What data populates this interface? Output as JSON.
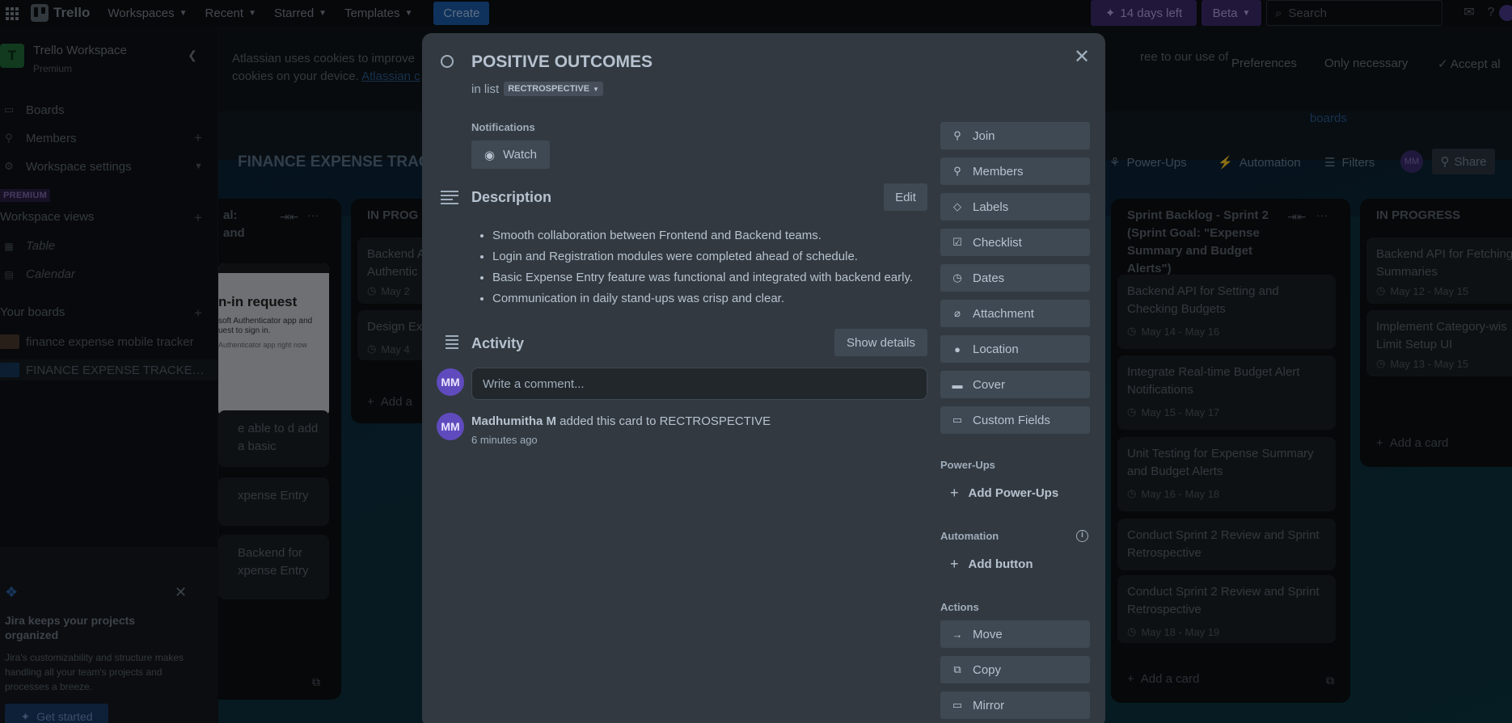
{
  "topbar": {
    "logo_text": "Trello",
    "nav": [
      {
        "label": "Workspaces"
      },
      {
        "label": "Recent"
      },
      {
        "label": "Starred"
      },
      {
        "label": "Templates"
      }
    ],
    "create_label": "Create",
    "trial_label": "14 days left",
    "beta_label": "Beta",
    "search_placeholder": "Search"
  },
  "sidebar": {
    "workspace_initial": "T",
    "workspace_name": "Trello Workspace",
    "workspace_plan": "Premium",
    "items": [
      {
        "label": "Boards"
      },
      {
        "label": "Members"
      },
      {
        "label": "Workspace settings"
      }
    ],
    "premium_tag": "PREMIUM",
    "views_heading": "Workspace views",
    "views": [
      {
        "label": "Table"
      },
      {
        "label": "Calendar"
      }
    ],
    "boards_heading": "Your boards",
    "boards": [
      {
        "name": "finance expense mobile tracker",
        "color": "#4a3a2c"
      },
      {
        "name": "FINANCE EXPENSE TRACKER U...",
        "color": "#173a5c"
      }
    ],
    "jira": {
      "title": "Jira keeps your projects organized",
      "text": "Jira's customizability and structure makes handling all your team's projects and processes a breeze.",
      "button": "Get started"
    }
  },
  "board": {
    "cookie_text_1": "Atlassian uses cookies to improve",
    "cookie_text_2": "cookies on your device.",
    "cookie_link": "Atlassian c",
    "cookie_right": "ree to our use of",
    "cookie_buttons": {
      "preferences": "Preferences",
      "only_necessary": "Only necessary",
      "accept": "Accept al"
    },
    "boards_link": "boards",
    "title": "FINANCE EXPENSE TRAC",
    "header_items": {
      "powerups": "Power-Ups",
      "automation": "Automation",
      "filters": "Filters"
    },
    "member_avatar": "MM",
    "share_label": "Share",
    "lists": [
      {
        "title_line1": "al:",
        "title_line2": "and",
        "image_heading": "n-in request",
        "image_text_1": "soft Authenticator app and",
        "image_text_2": "uest to sign in.",
        "image_text_3": "Authenticator app right now",
        "cards": [
          {
            "title": "e able to d add a basic"
          },
          {
            "title": "xpense Entry"
          },
          {
            "title": "Backend for xpense Entry"
          }
        ]
      },
      {
        "title": "IN PROG",
        "cards": [
          {
            "title": "Backend A Authentic",
            "date": "May 2"
          },
          {
            "title": "Design Ex",
            "date": "May 4"
          }
        ],
        "add_label": "Add a"
      },
      {
        "title": "Sprint Backlog - Sprint 2 (Sprint Goal: \"Expense Summary and Budget Alerts\")",
        "cards": [
          {
            "title": "Backend API for Setting and Checking Budgets",
            "date": "May 14 - May 16"
          },
          {
            "title": "Integrate Real-time Budget Alert Notifications",
            "date": "May 15 - May 17"
          },
          {
            "title": "Unit Testing for Expense Summary and Budget Alerts",
            "date": "May 16 - May 18"
          },
          {
            "title": "Conduct Sprint 2 Review and Sprint Retrospective",
            "date": ""
          },
          {
            "title": "Conduct Sprint 2 Review and Sprint Retrospective",
            "date": "May 18 - May 19"
          }
        ],
        "add_label": "Add a card"
      },
      {
        "title": "IN PROGRESS",
        "cards": [
          {
            "title": "Backend API for Fetching Summaries",
            "date": "May 12 - May 15"
          },
          {
            "title": "Implement Category-wis Limit Setup UI",
            "date": "May 13 - May 15"
          }
        ],
        "add_label": "Add a card"
      }
    ]
  },
  "modal": {
    "card_title": "POSITIVE OUTCOMES",
    "in_list_prefix": "in list",
    "list_name": "RECTROSPECTIVE",
    "notifications_label": "Notifications",
    "watch_label": "Watch",
    "description_heading": "Description",
    "edit_label": "Edit",
    "description_items": [
      "Smooth collaboration between Frontend and Backend teams.",
      "Login and Registration modules were completed ahead of schedule.",
      "Basic Expense Entry feature was functional and integrated with backend early.",
      "Communication in daily stand-ups was crisp and clear."
    ],
    "activity_heading": "Activity",
    "show_details_label": "Show details",
    "user_initials": "MM",
    "comment_placeholder": "Write a comment...",
    "activity_user": "Madhumitha M",
    "activity_action": "added this card to RECTROSPECTIVE",
    "activity_time": "6 minutes ago",
    "side_buttons": [
      {
        "label": "Join",
        "icon": "join-icon"
      },
      {
        "label": "Members",
        "icon": "members-icon"
      },
      {
        "label": "Labels",
        "icon": "labels-icon"
      },
      {
        "label": "Checklist",
        "icon": "checklist-icon"
      },
      {
        "label": "Dates",
        "icon": "clock-icon"
      },
      {
        "label": "Attachment",
        "icon": "paperclip-icon"
      },
      {
        "label": "Location",
        "icon": "location-icon"
      },
      {
        "label": "Cover",
        "icon": "cover-icon"
      },
      {
        "label": "Custom Fields",
        "icon": "custom-fields-icon"
      }
    ],
    "powerups_label": "Power-Ups",
    "add_powerups_label": "Add Power-Ups",
    "automation_label": "Automation",
    "add_button_label": "Add button",
    "actions_label": "Actions",
    "action_buttons": [
      {
        "label": "Move",
        "icon": "arrow-right-icon"
      },
      {
        "label": "Copy",
        "icon": "copy-icon"
      },
      {
        "label": "Mirror",
        "icon": "mirror-icon"
      }
    ]
  }
}
